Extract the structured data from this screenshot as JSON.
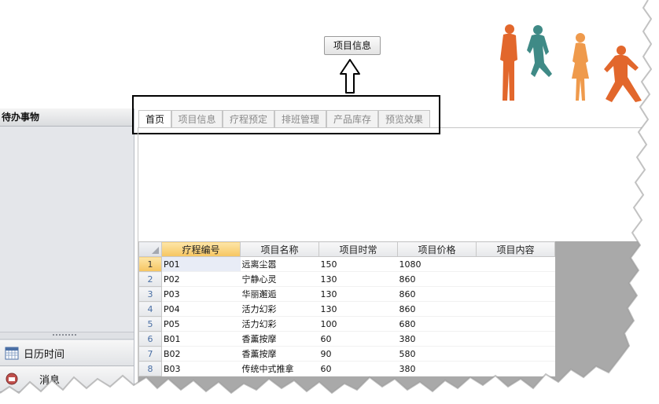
{
  "header": {
    "callout_button_label": "项目信息"
  },
  "tabs": [
    {
      "label": "首页",
      "active": true
    },
    {
      "label": "项目信息",
      "active": false
    },
    {
      "label": "疗程预定",
      "active": false
    },
    {
      "label": "排班管理",
      "active": false
    },
    {
      "label": "产品库存",
      "active": false
    },
    {
      "label": "预览效果",
      "active": false
    }
  ],
  "sidebar": {
    "title": "待办事物",
    "items": [
      {
        "label": "日历时间",
        "icon": "calendar-icon"
      },
      {
        "label": "消息",
        "icon": "message-icon"
      }
    ]
  },
  "grid": {
    "columns": [
      "疗程编号",
      "项目名称",
      "项目时常",
      "项目价格",
      "项目内容"
    ],
    "rows": [
      {
        "num": "1",
        "id": "P01",
        "name": "远离尘嚣",
        "time": "150",
        "price": "1080",
        "content": ""
      },
      {
        "num": "2",
        "id": "P02",
        "name": "宁静心灵",
        "time": "130",
        "price": "860",
        "content": ""
      },
      {
        "num": "3",
        "id": "P03",
        "name": "华丽邂逅",
        "time": "130",
        "price": "860",
        "content": ""
      },
      {
        "num": "4",
        "id": "P04",
        "name": "活力幻彩",
        "time": "130",
        "price": "860",
        "content": ""
      },
      {
        "num": "5",
        "id": "P05",
        "name": "活力幻彩",
        "time": "100",
        "price": "680",
        "content": ""
      },
      {
        "num": "6",
        "id": "B01",
        "name": "香薰按摩",
        "time": "60",
        "price": "380",
        "content": ""
      },
      {
        "num": "7",
        "id": "B02",
        "name": "香薰按摩",
        "time": "90",
        "price": "580",
        "content": ""
      },
      {
        "num": "8",
        "id": "B03",
        "name": "传统中式推拿",
        "time": "60",
        "price": "380",
        "content": ""
      }
    ]
  },
  "colors": {
    "figure_orange": "#e2672c",
    "figure_teal": "#3f8a86",
    "figure_light_orange": "#ef9a4c",
    "selected_header": "#f6c560"
  }
}
